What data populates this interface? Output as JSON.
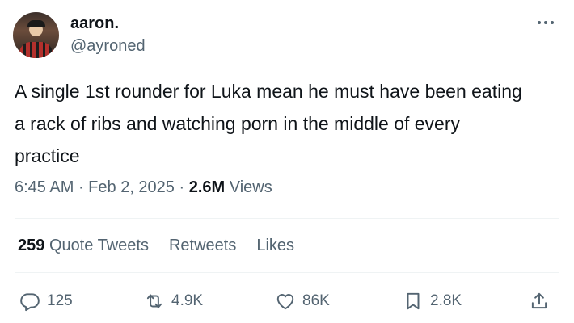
{
  "user": {
    "display_name": "aaron.",
    "handle": "@ayroned"
  },
  "tweet": {
    "text": "A single 1st rounder for Luka mean he must have been eating\na rack of ribs and watching porn in the middle of every\npractice",
    "time": "6:45 AM",
    "date": "Feb 2, 2025",
    "views_count": "2.6M",
    "views_label": "Views"
  },
  "stats": {
    "quote_count": "259",
    "quote_label": "Quote Tweets",
    "retweets_label": "Retweets",
    "likes_label": "Likes"
  },
  "actions": {
    "replies": "125",
    "retweets": "4.9K",
    "likes": "86K",
    "bookmarks": "2.8K"
  },
  "icons": [
    "avatar",
    "more-icon",
    "reply-icon",
    "retweet-icon",
    "like-icon",
    "bookmark-icon",
    "share-icon"
  ],
  "colors": {
    "primary_text": "#0f1419",
    "secondary_text": "#536471",
    "divider": "#eff3f4"
  }
}
